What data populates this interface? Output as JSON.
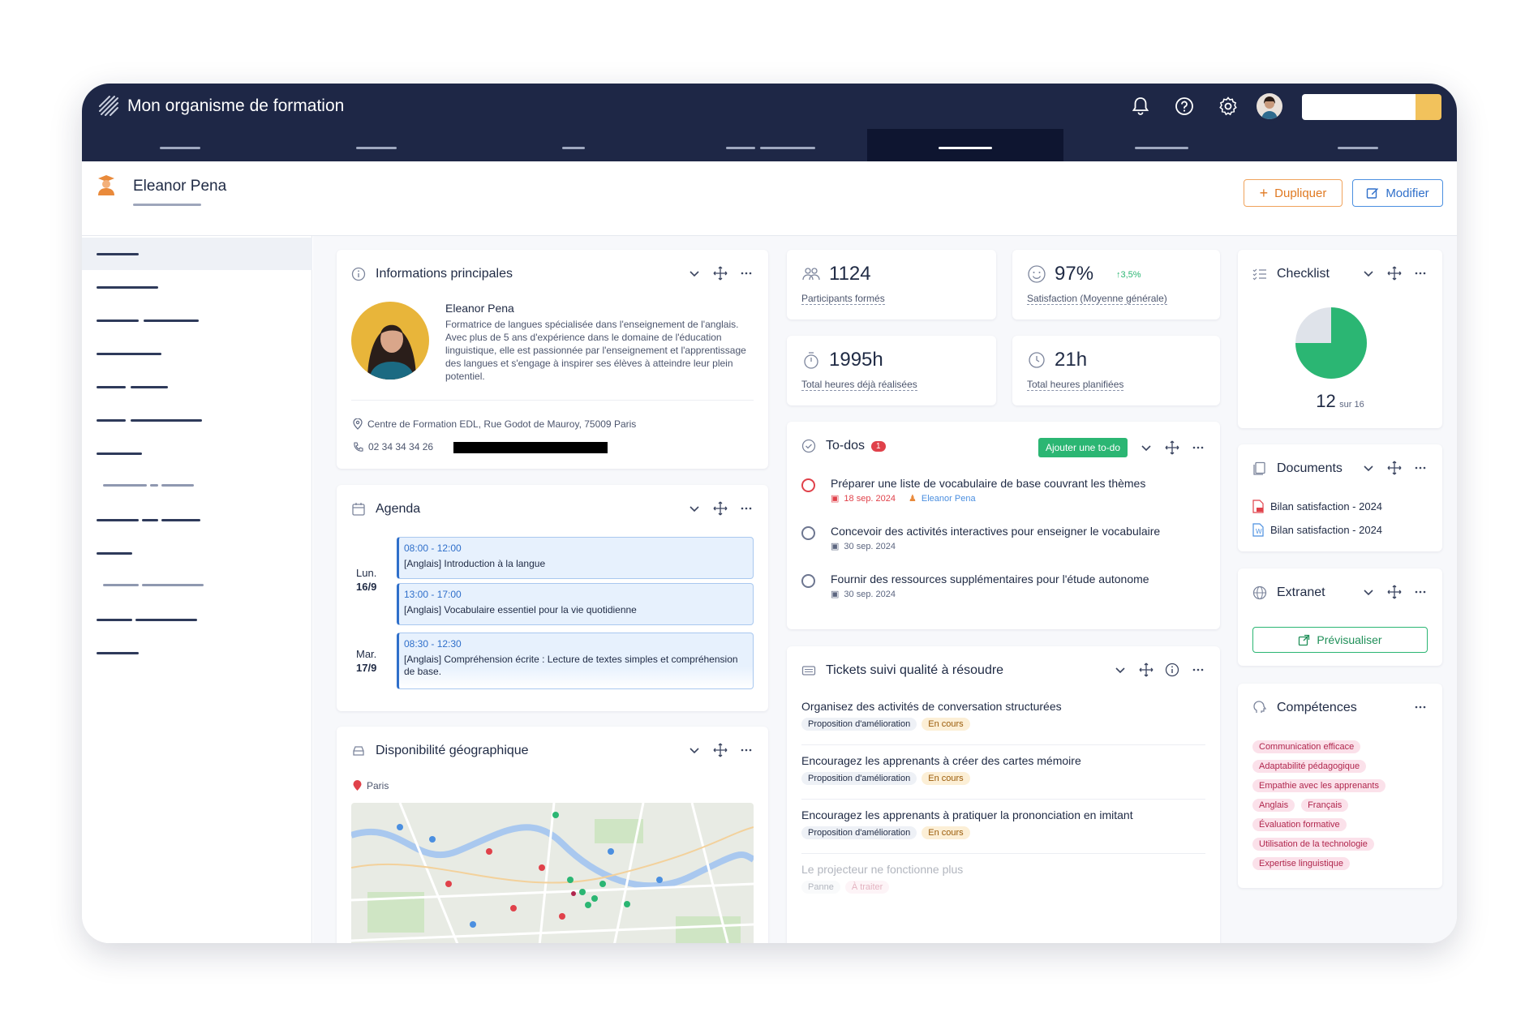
{
  "app": {
    "title": "Mon organisme de formation"
  },
  "page": {
    "title": "Eleanor Pena",
    "duplicate_label": "Dupliquer",
    "edit_label": "Modifier"
  },
  "info": {
    "title": "Informations principales",
    "name": "Eleanor Pena",
    "bio": "Formatrice de langues spécialisée dans l'enseignement de l'anglais. Avec plus de 5 ans d'expérience dans le domaine de l'éducation linguistique, elle est passionnée par l'enseignement et l'apprentissage des langues et s'engage à inspirer ses élèves à atteindre leur plein potentiel.",
    "address": "Centre de Formation EDL, Rue Godot de Mauroy, 75009 Paris",
    "phone": "02 34 34 34 26"
  },
  "stats": {
    "participants": {
      "value": "1124",
      "label": "Participants formés"
    },
    "satisfaction": {
      "value": "97%",
      "delta": "3,5%",
      "label": "Satisfaction (Moyenne générale)"
    },
    "hours_done": {
      "value": "1995h",
      "label": "Total heures déjà réalisées"
    },
    "hours_planned": {
      "value": "21h",
      "label": "Total heures planifiées"
    }
  },
  "checklist": {
    "title": "Checklist",
    "done": "12",
    "total_label": "sur 16",
    "fraction": 0.75
  },
  "agenda": {
    "title": "Agenda",
    "days": [
      {
        "day": "Lun.",
        "date": "16/9"
      },
      {
        "day": "Mar.",
        "date": "17/9"
      }
    ],
    "events": [
      {
        "time": "08:00 - 12:00",
        "text": "[Anglais] Introduction à la langue"
      },
      {
        "time": "13:00 - 17:00",
        "text": "[Anglais] Vocabulaire essentiel pour la vie quotidienne"
      },
      {
        "time": "08:30 - 12:30",
        "text": "[Anglais] Compréhension écrite : Lecture de textes simples et compréhension de base."
      }
    ]
  },
  "todos": {
    "title": "To-dos",
    "badge": "1",
    "add_label": "Ajouter une to-do",
    "items": [
      {
        "text": "Préparer une liste de vocabulaire de base couvrant les thèmes",
        "date": "18 sep. 2024",
        "assignee": "Eleanor Pena"
      },
      {
        "text": "Concevoir des activités interactives pour enseigner le vocabulaire",
        "date": "30 sep. 2024"
      },
      {
        "text": "Fournir des ressources supplémentaires pour l'étude autonome",
        "date": "30 sep. 2024"
      }
    ]
  },
  "documents": {
    "title": "Documents",
    "items": [
      {
        "name": "Bilan satisfaction - 2024",
        "icon": "pdf-icon"
      },
      {
        "name": "Bilan satisfaction - 2024",
        "icon": "word-icon"
      }
    ]
  },
  "extranet": {
    "title": "Extranet",
    "preview_label": "Prévisualiser"
  },
  "tickets": {
    "title": "Tickets suivi qualité à résoudre",
    "items": [
      {
        "title": "Organisez des activités de conversation structurées",
        "type": "Proposition d'amélioration",
        "status": "En cours"
      },
      {
        "title": "Encouragez les apprenants à créer des cartes mémoire",
        "type": "Proposition d'amélioration",
        "status": "En cours"
      },
      {
        "title": "Encouragez les apprenants à pratiquer la prononciation en imitant",
        "type": "Proposition d'amélioration",
        "status": "En cours"
      },
      {
        "title": "Le projecteur ne fonctionne plus",
        "type": "Panne",
        "status": "À traiter"
      }
    ]
  },
  "geo": {
    "title": "Disponibilité géographique",
    "city": "Paris"
  },
  "skills": {
    "title": "Compétences",
    "items": [
      "Communication efficace",
      "Adaptabilité pédagogique",
      "Empathie avec les apprenants",
      "Anglais",
      "Français",
      "Évaluation formative",
      "Utilisation de la technologie",
      "Expertise linguistique"
    ]
  },
  "colors": {
    "navy": "#1e2746",
    "accent_orange": "#e07a23",
    "accent_blue": "#2f6fca",
    "success": "#2bb673"
  }
}
